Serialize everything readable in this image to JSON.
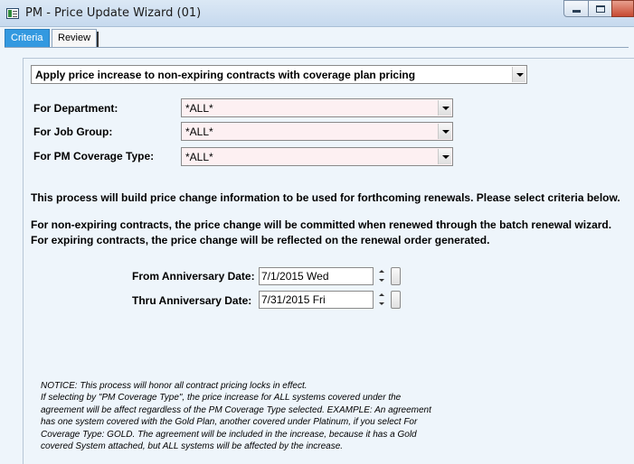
{
  "window": {
    "title": "PM - Price Update Wizard (01)"
  },
  "tabs": [
    {
      "label": "Criteria"
    },
    {
      "label": "Review"
    }
  ],
  "criteria": {
    "action": "Apply price increase to non-expiring contracts with coverage plan pricing",
    "department_label": "For Department:",
    "department_value": "*ALL*",
    "job_group_label": "For Job Group:",
    "job_group_value": "*ALL*",
    "coverage_type_label": "For PM Coverage Type:",
    "coverage_type_value": "*ALL*"
  },
  "info": {
    "line1": "This process will build price change information to be used for forthcoming renewals. Please select criteria below.",
    "line2": "For non-expiring contracts, the price change will be committed when renewed through the batch renewal wizard.",
    "line3": "For expiring contracts, the price change will be reflected on the renewal order generated."
  },
  "dates": {
    "from_label": "From Anniversary Date:",
    "from_value": "7/1/2015 Wed",
    "thru_label": "Thru Anniversary Date:",
    "thru_value": "7/31/2015 Fri"
  },
  "notice": [
    "NOTICE:  This process will honor all contract pricing locks in effect.",
    "If selecting by \"PM Coverage Type\",  the price increase for ALL systems covered under the",
    "agreement will be affect regardless of the PM Coverage Type selected.   EXAMPLE:  An agreement",
    "has one system covered with the Gold Plan,  another covered under Platinum, if you select For",
    "Coverage Type: GOLD.  The agreement will be included in the increase, because it has a Gold",
    "covered System attached, but ALL systems will be affected by the increase."
  ],
  "icons": {
    "app": "app-window-icon",
    "minimize": "minimize-icon",
    "maximize": "maximize-icon",
    "close": "close-icon",
    "dropdown": "chevron-down-icon",
    "spin": "spinner-arrows-icon",
    "calendar": "calendar-button-icon"
  },
  "colors": {
    "tab_active": "#3399e0",
    "close_button": "#c74a32",
    "field_pink": "#fdf0f2",
    "background": "#eef5fb"
  }
}
